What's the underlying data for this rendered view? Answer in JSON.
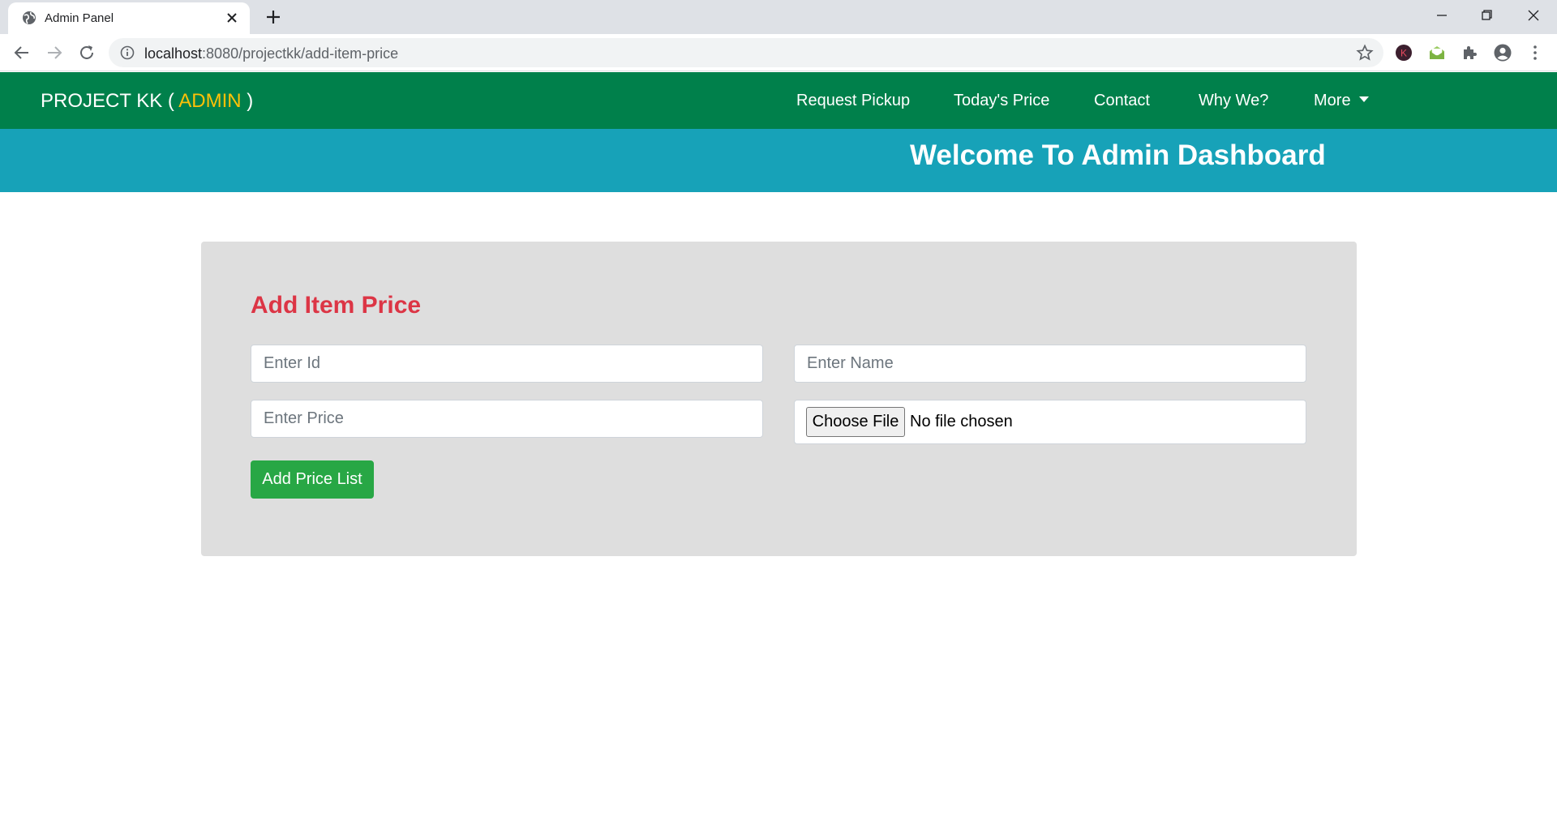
{
  "browser": {
    "tab": {
      "title": "Admin Panel"
    },
    "address_bar": {
      "host": "localhost",
      "path": ":8080/projectkk/add-item-price"
    },
    "extension_avatar_letter": "K"
  },
  "navbar": {
    "brand_prefix": "PROJECT KK ( ",
    "brand_accent": "ADMIN",
    "brand_suffix": " )",
    "links": [
      "Request Pickup",
      "Today's Price",
      "Contact",
      "Why We?",
      "More"
    ],
    "colors": {
      "background": "#00804b",
      "accent": "#ffc107"
    }
  },
  "banner": {
    "title": "Welcome To Admin Dashboard",
    "background": "#17a2b8"
  },
  "form": {
    "title": "Add Item Price",
    "id_field": {
      "placeholder": "Enter Id",
      "value": ""
    },
    "name_field": {
      "placeholder": "Enter Name",
      "value": ""
    },
    "price_field": {
      "placeholder": "Enter Price",
      "value": ""
    },
    "file_input": {
      "button_label": "Choose File",
      "status": "No file chosen"
    },
    "submit_label": "Add Price List",
    "colors": {
      "title": "#dc3545",
      "submit": "#28a745",
      "card": "#dedede"
    }
  }
}
